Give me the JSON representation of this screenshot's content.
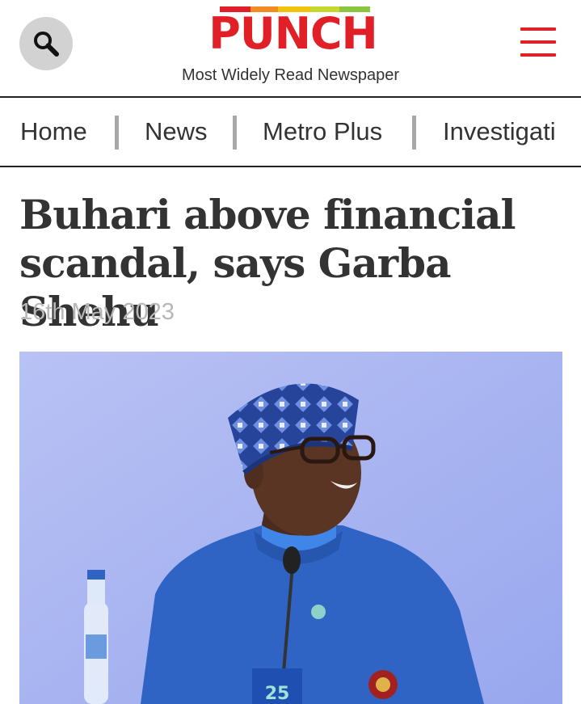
{
  "header": {
    "logo": "PUNCH",
    "tagline": "Most Widely Read Newspaper",
    "logo_bar_colors": [
      "#e11f26",
      "#f4c20d",
      "#8cc63f"
    ]
  },
  "nav": {
    "items": [
      {
        "label": "Home"
      },
      {
        "label": "News"
      },
      {
        "label": "Metro Plus"
      },
      {
        "label": "Investigati"
      }
    ]
  },
  "article": {
    "headline": "Buhari above financial scandal, says Garba Shehu",
    "date": "16th May 2023",
    "image_label": "25"
  },
  "colors": {
    "brand_red": "#e11f26",
    "photo_bg": "#a9b5f2",
    "agbada_blue": "#2f63c4"
  }
}
